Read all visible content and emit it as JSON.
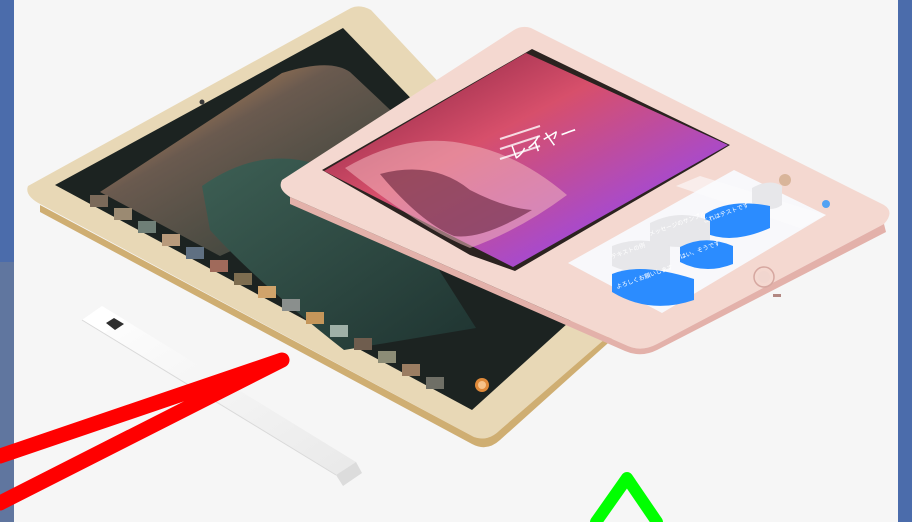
{
  "scene": {
    "subject": "ipad-pro-pair-with-pencil",
    "background_color": "#4f6fb0",
    "panel_color": "#f6f6f6",
    "front_ipad_color": "#f1d6cf",
    "back_ipad_color": "#ead8b3"
  },
  "front_ipad": {
    "canvas_text": "レイヤー",
    "messages": [
      "これはテストです",
      "メッセージのサンプル",
      "はい、そうです",
      "テキストの例",
      "よろしくお願いします",
      "ありがとう"
    ]
  },
  "annotations": {
    "red_arrow_color": "#ff0000",
    "green_arrow_color": "#00ff00"
  }
}
